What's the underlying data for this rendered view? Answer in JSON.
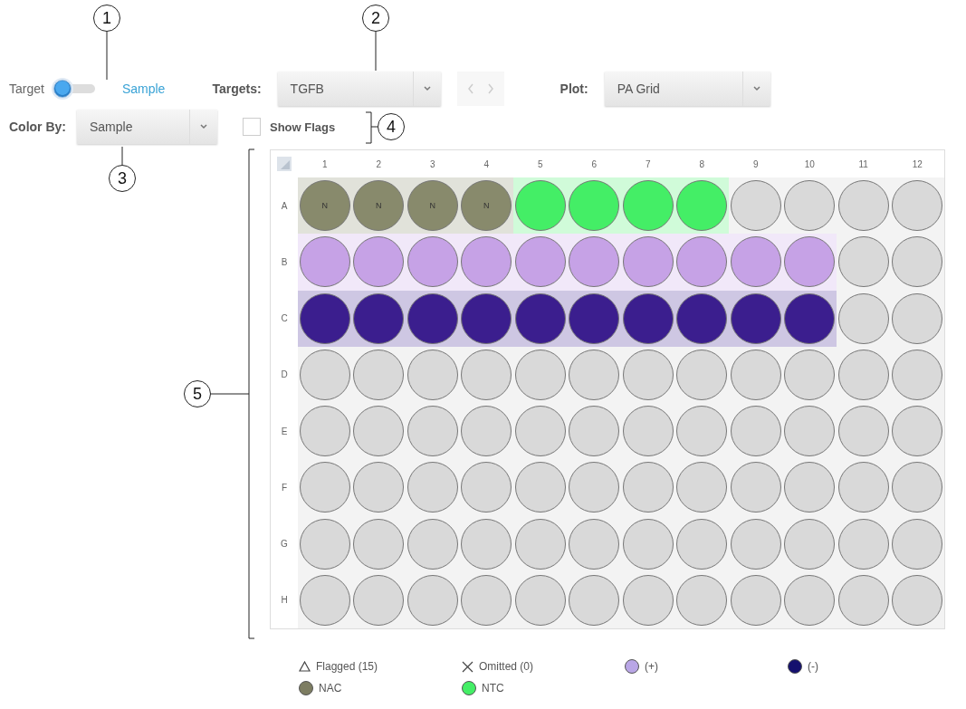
{
  "callouts": [
    "1",
    "2",
    "3",
    "4",
    "5"
  ],
  "toggle": {
    "options": [
      {
        "label": "Target",
        "selected": false
      },
      {
        "label": "Sample",
        "selected": true
      }
    ],
    "on": false
  },
  "targets": {
    "label": "Targets:",
    "value": "TGFB"
  },
  "plot": {
    "label": "Plot:",
    "value": "PA Grid"
  },
  "color_by": {
    "label": "Color By:",
    "value": "Sample"
  },
  "show_flags": {
    "label": "Show Flags",
    "checked": false
  },
  "plate": {
    "columns": [
      "1",
      "2",
      "3",
      "4",
      "5",
      "6",
      "7",
      "8",
      "9",
      "10",
      "11",
      "12"
    ],
    "rows": [
      {
        "label": "A",
        "wells": [
          {
            "color": "#888a6c",
            "text": "N"
          },
          {
            "color": "#888a6c",
            "text": "N"
          },
          {
            "color": "#888a6c",
            "text": "N"
          },
          {
            "color": "#888a6c",
            "text": "N"
          },
          {
            "color": "#44ee66"
          },
          {
            "color": "#44ee66"
          },
          {
            "color": "#44ee66"
          },
          {
            "color": "#44ee66"
          },
          {
            "color": "#d9d9d9"
          },
          {
            "color": "#d9d9d9"
          },
          {
            "color": "#d9d9d9"
          },
          {
            "color": "#d9d9d9"
          }
        ]
      },
      {
        "label": "B",
        "wells": [
          {
            "color": "#c6a2e6"
          },
          {
            "color": "#c6a2e6"
          },
          {
            "color": "#c6a2e6"
          },
          {
            "color": "#c6a2e6"
          },
          {
            "color": "#c6a2e6"
          },
          {
            "color": "#c6a2e6"
          },
          {
            "color": "#c6a2e6"
          },
          {
            "color": "#c6a2e6"
          },
          {
            "color": "#c6a2e6"
          },
          {
            "color": "#c6a2e6"
          },
          {
            "color": "#d9d9d9"
          },
          {
            "color": "#d9d9d9"
          }
        ]
      },
      {
        "label": "C",
        "wells": [
          {
            "color": "#3b1e8e"
          },
          {
            "color": "#3b1e8e"
          },
          {
            "color": "#3b1e8e"
          },
          {
            "color": "#3b1e8e"
          },
          {
            "color": "#3b1e8e"
          },
          {
            "color": "#3b1e8e"
          },
          {
            "color": "#3b1e8e"
          },
          {
            "color": "#3b1e8e"
          },
          {
            "color": "#3b1e8e"
          },
          {
            "color": "#3b1e8e"
          },
          {
            "color": "#d9d9d9"
          },
          {
            "color": "#d9d9d9"
          }
        ]
      },
      {
        "label": "D",
        "wells": [
          {
            "color": "#d9d9d9"
          },
          {
            "color": "#d9d9d9"
          },
          {
            "color": "#d9d9d9"
          },
          {
            "color": "#d9d9d9"
          },
          {
            "color": "#d9d9d9"
          },
          {
            "color": "#d9d9d9"
          },
          {
            "color": "#d9d9d9"
          },
          {
            "color": "#d9d9d9"
          },
          {
            "color": "#d9d9d9"
          },
          {
            "color": "#d9d9d9"
          },
          {
            "color": "#d9d9d9"
          },
          {
            "color": "#d9d9d9"
          }
        ]
      },
      {
        "label": "E",
        "wells": [
          {
            "color": "#d9d9d9"
          },
          {
            "color": "#d9d9d9"
          },
          {
            "color": "#d9d9d9"
          },
          {
            "color": "#d9d9d9"
          },
          {
            "color": "#d9d9d9"
          },
          {
            "color": "#d9d9d9"
          },
          {
            "color": "#d9d9d9"
          },
          {
            "color": "#d9d9d9"
          },
          {
            "color": "#d9d9d9"
          },
          {
            "color": "#d9d9d9"
          },
          {
            "color": "#d9d9d9"
          },
          {
            "color": "#d9d9d9"
          }
        ]
      },
      {
        "label": "F",
        "wells": [
          {
            "color": "#d9d9d9"
          },
          {
            "color": "#d9d9d9"
          },
          {
            "color": "#d9d9d9"
          },
          {
            "color": "#d9d9d9"
          },
          {
            "color": "#d9d9d9"
          },
          {
            "color": "#d9d9d9"
          },
          {
            "color": "#d9d9d9"
          },
          {
            "color": "#d9d9d9"
          },
          {
            "color": "#d9d9d9"
          },
          {
            "color": "#d9d9d9"
          },
          {
            "color": "#d9d9d9"
          },
          {
            "color": "#d9d9d9"
          }
        ]
      },
      {
        "label": "G",
        "wells": [
          {
            "color": "#d9d9d9"
          },
          {
            "color": "#d9d9d9"
          },
          {
            "color": "#d9d9d9"
          },
          {
            "color": "#d9d9d9"
          },
          {
            "color": "#d9d9d9"
          },
          {
            "color": "#d9d9d9"
          },
          {
            "color": "#d9d9d9"
          },
          {
            "color": "#d9d9d9"
          },
          {
            "color": "#d9d9d9"
          },
          {
            "color": "#d9d9d9"
          },
          {
            "color": "#d9d9d9"
          },
          {
            "color": "#d9d9d9"
          }
        ]
      },
      {
        "label": "H",
        "wells": [
          {
            "color": "#d9d9d9"
          },
          {
            "color": "#d9d9d9"
          },
          {
            "color": "#d9d9d9"
          },
          {
            "color": "#d9d9d9"
          },
          {
            "color": "#d9d9d9"
          },
          {
            "color": "#d9d9d9"
          },
          {
            "color": "#d9d9d9"
          },
          {
            "color": "#d9d9d9"
          },
          {
            "color": "#d9d9d9"
          },
          {
            "color": "#d9d9d9"
          },
          {
            "color": "#d9d9d9"
          },
          {
            "color": "#d9d9d9"
          }
        ]
      }
    ]
  },
  "legend": [
    {
      "kind": "flagged",
      "label": "Flagged (15)"
    },
    {
      "kind": "omitted",
      "label": "Omitted (0)"
    },
    {
      "kind": "sample",
      "label": "(+)",
      "color": "#b9a6e6"
    },
    {
      "kind": "sample",
      "label": "(-)",
      "color": "#14106e"
    },
    {
      "kind": "sample",
      "label": "NAC",
      "color": "#7d7d62"
    },
    {
      "kind": "sample",
      "label": "NTC",
      "color": "#44ee66"
    }
  ]
}
